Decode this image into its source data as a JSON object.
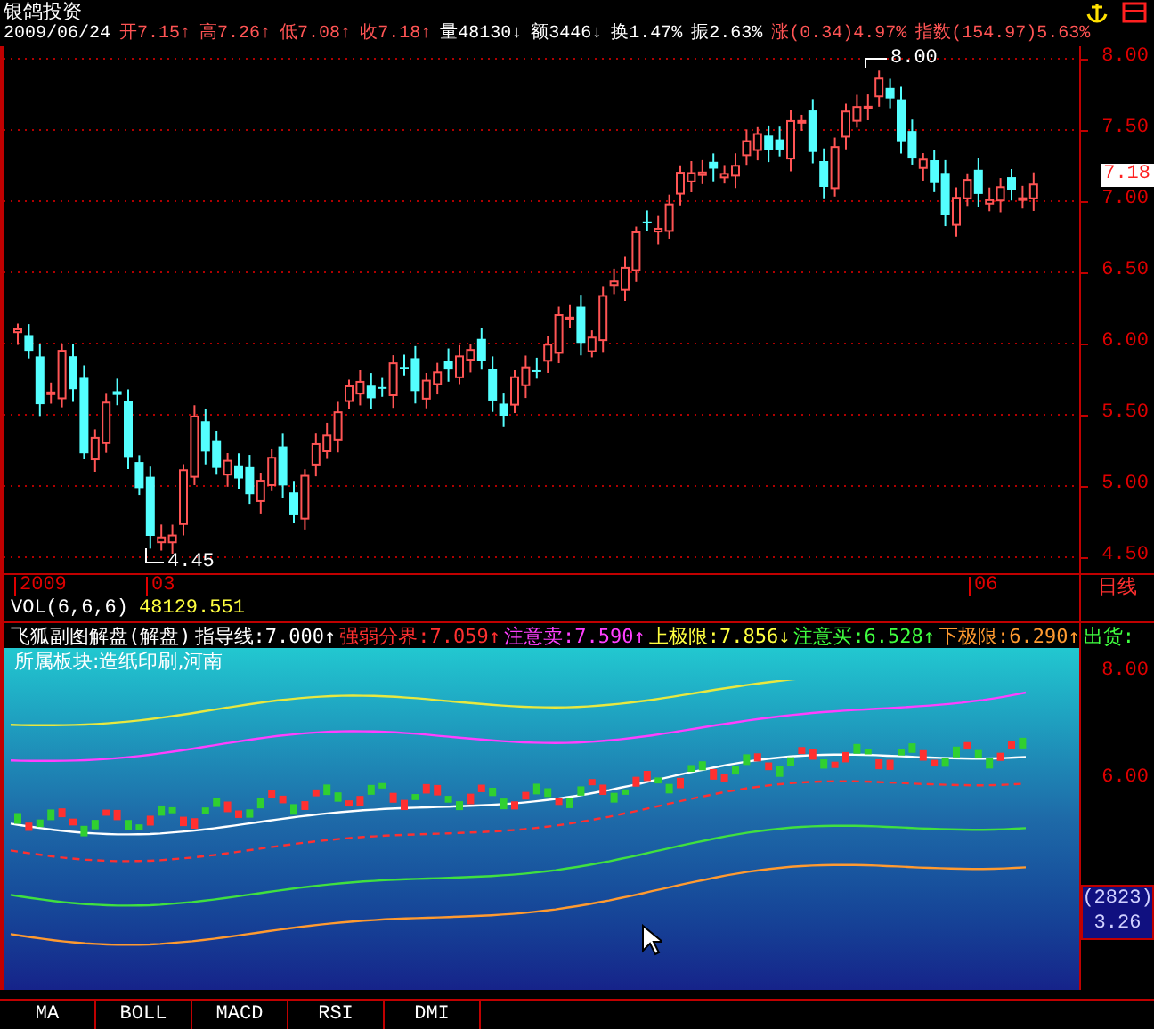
{
  "window": {
    "title": "银鸽投资"
  },
  "quote": [
    {
      "text": "2009/06/24",
      "color": "#ffffff"
    },
    {
      "text": "开7.15↑",
      "color": "#ff5454"
    },
    {
      "text": "高7.26↑",
      "color": "#ff5454"
    },
    {
      "text": "低7.08↑",
      "color": "#ff5454"
    },
    {
      "text": "收7.18↑",
      "color": "#ff5454"
    },
    {
      "text": "量48130↓",
      "color": "#ffffff"
    },
    {
      "text": "额3446↓",
      "color": "#ffffff"
    },
    {
      "text": "换1.47%",
      "color": "#ffffff"
    },
    {
      "text": "振2.63%",
      "color": "#ffffff"
    },
    {
      "text": "涨(0.34)4.97%",
      "color": "#ff5454"
    },
    {
      "text": "指数(154.97)5.63%",
      "color": "#ff5454"
    }
  ],
  "main_chart": {
    "high_label": "8.00",
    "low_label": "4.45",
    "current_price": "7.18",
    "price_axis": [
      "8.00",
      "7.50",
      "7.00",
      "6.50",
      "6.00",
      "5.50",
      "5.00",
      "4.50"
    ],
    "time_axis": [
      "2009",
      "03",
      "06"
    ],
    "period": "日线"
  },
  "volume": {
    "label": "VOL(6,6,6)",
    "value": "48129.551"
  },
  "indicator": {
    "items": [
      {
        "text": "飞狐副图解盘(解盘)",
        "color": "#ffffff"
      },
      {
        "text": "指导线:7.000↑",
        "color": "#ffffff"
      },
      {
        "text": "强弱分界:7.059↑",
        "color": "#ff3030"
      },
      {
        "text": "注意卖:7.590↑",
        "color": "#ff40ff"
      },
      {
        "text": "上极限:7.856↓",
        "color": "#ffff40"
      },
      {
        "text": "注意买:6.528↑",
        "color": "#40ff40"
      },
      {
        "text": "下极限:6.290↑",
        "color": "#ff9a30"
      },
      {
        "text": "出货:",
        "color": "#40ff40"
      }
    ],
    "sector": "所属板块:造纸印刷,河南",
    "axis": [
      "8.00",
      "6.00"
    ],
    "readout": {
      "code": "(2823)",
      "value": "3.26"
    }
  },
  "tabs": [
    {
      "label": "MA",
      "selected": false
    },
    {
      "label": "BOLL",
      "selected": false
    },
    {
      "label": "MACD",
      "selected": false
    },
    {
      "label": "RSI",
      "selected": false
    },
    {
      "label": "DMI",
      "selected": false
    }
  ]
}
